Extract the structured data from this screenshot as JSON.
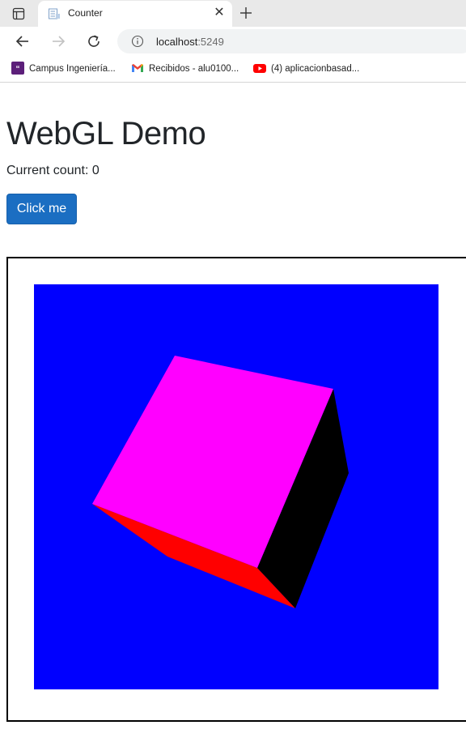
{
  "browser": {
    "tab": {
      "title": "Counter"
    },
    "address": {
      "host": "localhost",
      "port": ":5249"
    },
    "bookmarks": [
      {
        "label": "Campus Ingeniería...",
        "icon": "campus-icon"
      },
      {
        "label": "Recibidos - alu0100...",
        "icon": "gmail-icon"
      },
      {
        "label": "(4) aplicacionbasad...",
        "icon": "youtube-icon"
      }
    ]
  },
  "page": {
    "title": "WebGL Demo",
    "count_label": "Current count: 0",
    "button_label": "Click me"
  },
  "scene": {
    "background_color": "#0000ff",
    "faces": [
      {
        "name": "top-face",
        "color": "#ff00ff"
      },
      {
        "name": "side-face",
        "color": "#000000"
      },
      {
        "name": "bottom-face",
        "color": "#ff0000"
      }
    ]
  }
}
